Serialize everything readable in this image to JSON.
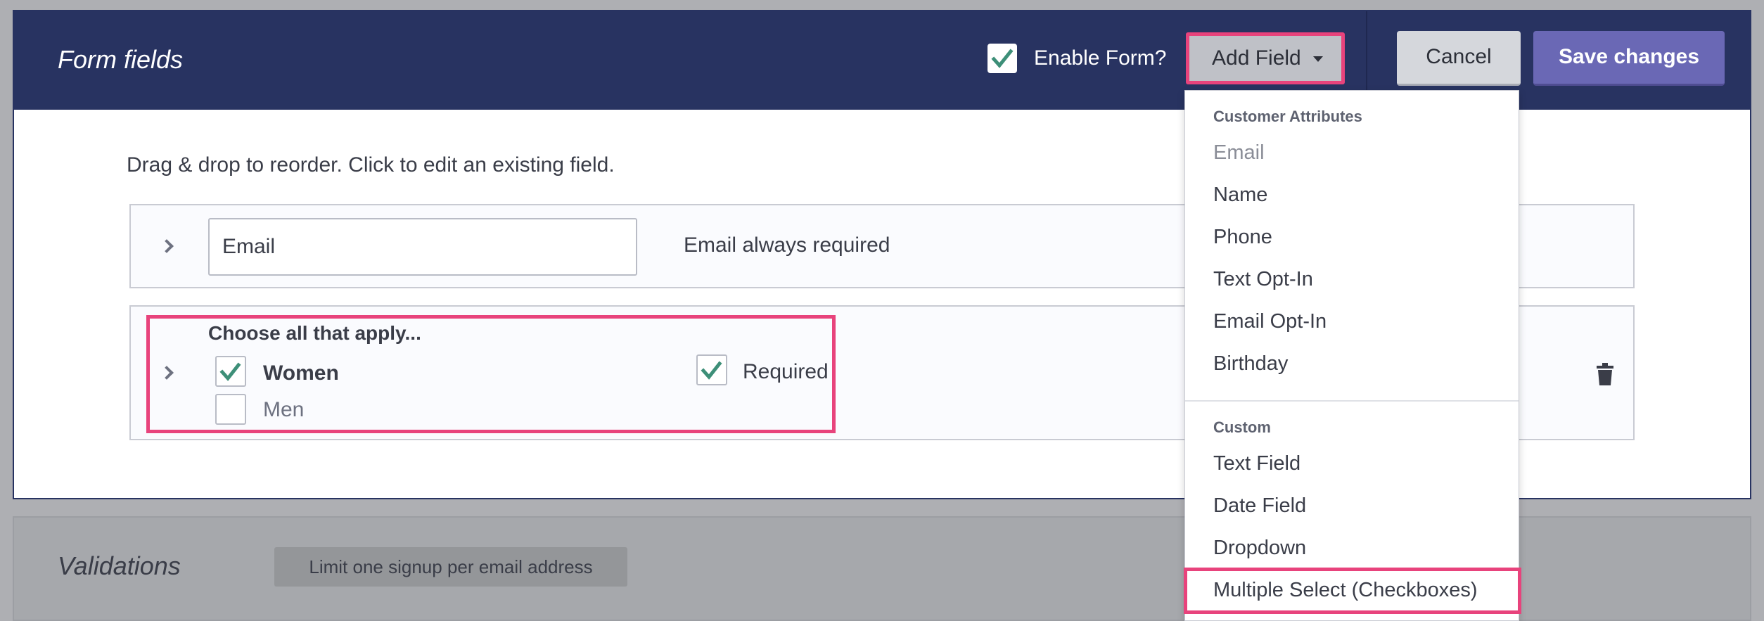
{
  "form_fields": {
    "title": "Form fields",
    "enable_form": {
      "label": "Enable Form?",
      "checked": true
    },
    "add_field_button": "Add Field",
    "cancel_button": "Cancel",
    "save_button": "Save changes",
    "instructions": "Drag & drop to reorder. Click to edit an existing field.",
    "fields": [
      {
        "input_value": "Email",
        "note": "Email always required"
      },
      {
        "question": "Choose all that apply...",
        "options": [
          {
            "label": "Women",
            "checked": true
          },
          {
            "label": "Men",
            "checked": false
          }
        ],
        "required_label": "Required",
        "required_checked": true
      }
    ]
  },
  "validations": {
    "title": "Validations",
    "chip": "Limit one signup per email address"
  },
  "add_field_menu": {
    "section_1_header": "Customer Attributes",
    "section_1_items": [
      "Email",
      "Name",
      "Phone",
      "Text Opt-In",
      "Email Opt-In",
      "Birthday"
    ],
    "section_2_header": "Custom",
    "section_2_items": [
      "Text Field",
      "Date Field",
      "Dropdown",
      "Multiple Select (Checkboxes)"
    ]
  },
  "colors": {
    "header_bg": "#283361",
    "highlight": "#e8437c",
    "save_button": "#6a68b5",
    "check": "#3d8f78"
  }
}
